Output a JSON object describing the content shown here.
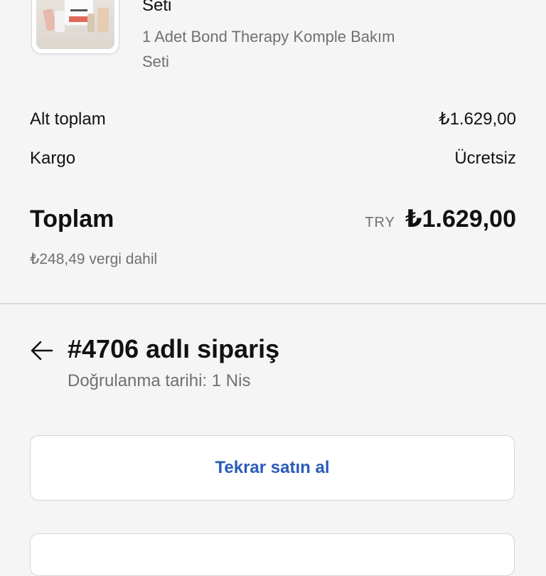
{
  "product": {
    "name": "Seti",
    "variant": "1 Adet Bond Therapy Komple Bakım Seti",
    "image_icon": "product-image"
  },
  "summary": {
    "subtotal_label": "Alt toplam",
    "subtotal_value": "₺1.629,00",
    "shipping_label": "Kargo",
    "shipping_value": "Ücretsiz",
    "total_label": "Toplam",
    "currency": "TRY",
    "total_value": "₺1.629,00",
    "tax_note": "₺248,49 vergi dahil"
  },
  "order": {
    "back_icon": "arrow-left-icon",
    "title": "#4706 adlı sipariş",
    "confirmation": "Doğrulanma tarihi: 1 Nis"
  },
  "actions": {
    "buy_again_label": "Tekrar satın al"
  },
  "colors": {
    "background": "#f5f5f5",
    "link_blue": "#2a5bb8",
    "muted_text": "#707070"
  }
}
